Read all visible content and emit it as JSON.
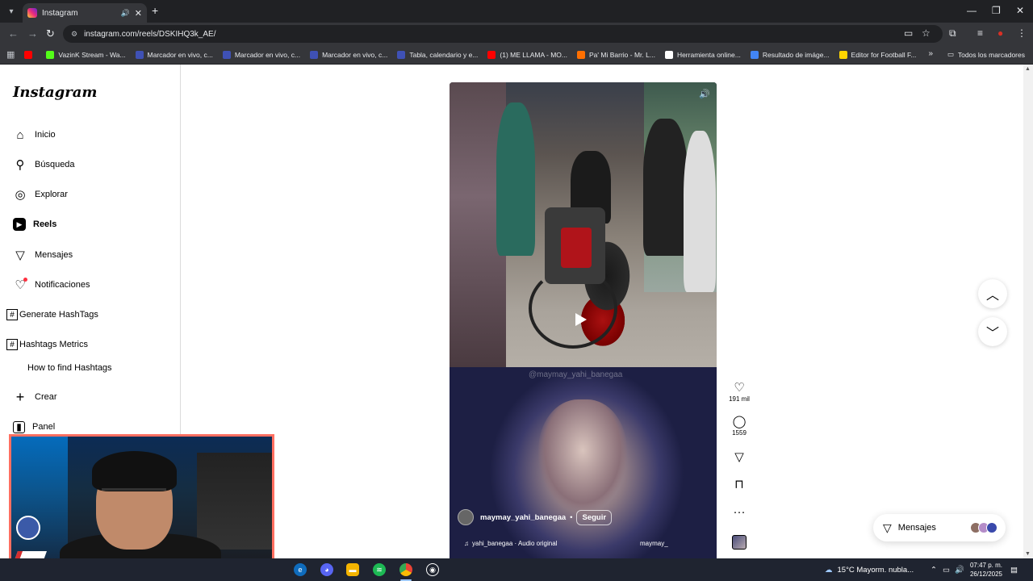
{
  "browser": {
    "tab_title": "Instagram",
    "url": "instagram.com/reels/DSKIHQ3k_AE/",
    "bookmarks": [
      {
        "label": "",
        "color": "#ff0000"
      },
      {
        "label": "VazinK Stream - Wa...",
        "color": "#53fc18"
      },
      {
        "label": "Marcador en vivo, c...",
        "color": "#3f51b5"
      },
      {
        "label": "Marcador en vivo, c...",
        "color": "#3f51b5"
      },
      {
        "label": "Marcador en vivo, c...",
        "color": "#3f51b5"
      },
      {
        "label": "Tabla, calendario y e...",
        "color": "#3f51b5"
      },
      {
        "label": "(1) ME LLAMA - MO...",
        "color": "#ff0000"
      },
      {
        "label": "Pa' Mi Barrio - Mr. L...",
        "color": "#ff6f00"
      },
      {
        "label": "Herramienta online...",
        "color": "#ffffff"
      },
      {
        "label": "Resultado de imáge...",
        "color": "#4285f4"
      },
      {
        "label": "Editor for Football F...",
        "color": "#ffd600"
      }
    ],
    "bookmarks_folder": "Todos los marcadores"
  },
  "sidebar": {
    "logo": "Instagram",
    "items": [
      {
        "label": "Inicio",
        "icon": "home-icon"
      },
      {
        "label": "Búsqueda",
        "icon": "search-icon"
      },
      {
        "label": "Explorar",
        "icon": "compass-icon"
      },
      {
        "label": "Reels",
        "icon": "reels-icon"
      },
      {
        "label": "Mensajes",
        "icon": "send-icon"
      },
      {
        "label": "Notificaciones",
        "icon": "heart-icon"
      }
    ],
    "hashtag_items": [
      {
        "label": "Generate HashTags"
      },
      {
        "label": "Hashtags Metrics"
      }
    ],
    "sub_item": "How to find Hashtags",
    "create": "Crear",
    "panel": "Panel"
  },
  "reel": {
    "watermark": "@maymay_yahi_banegaa",
    "username": "maymay_yahi_banegaa",
    "dot": "•",
    "follow": "Seguir",
    "audio": "yahi_banegaa · Audio original",
    "audio_handle": "maymay_",
    "likes": "191 mil",
    "comments": "1559"
  },
  "messages_pill": {
    "label": "Mensajes"
  },
  "taskbar": {
    "weather": "15°C  Mayorm. nubla...",
    "time": "07:47 p. m.",
    "date": "26/12/2025"
  }
}
